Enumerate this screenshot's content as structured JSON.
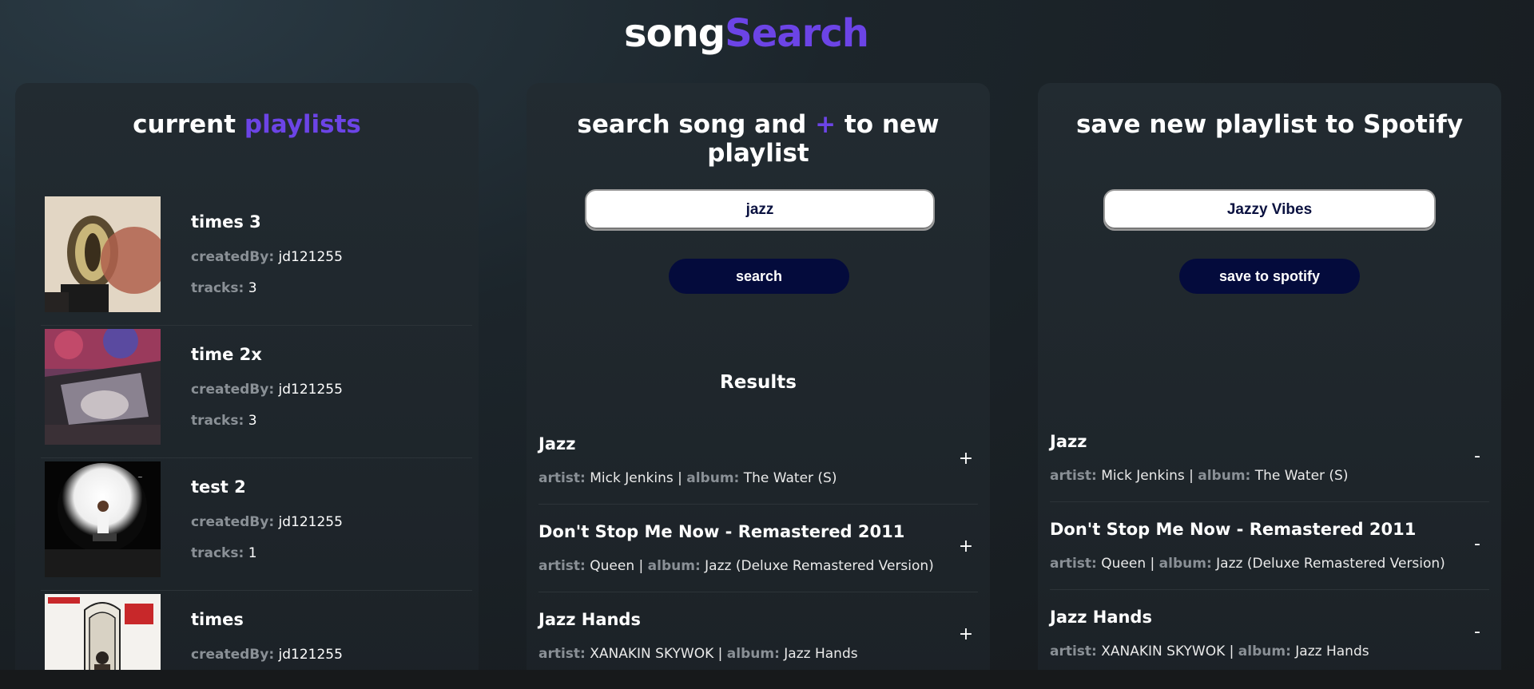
{
  "header": {
    "title_part1": "song",
    "title_part2": "Search"
  },
  "playlists_panel": {
    "title_part1": "current",
    "title_part2": "playlists",
    "created_label": "createdBy:",
    "tracks_label": "tracks:",
    "items": [
      {
        "name": "times 3",
        "created_by": "jd121255",
        "tracks": "3"
      },
      {
        "name": "time 2x",
        "created_by": "jd121255",
        "tracks": "3"
      },
      {
        "name": "test 2",
        "created_by": "jd121255",
        "tracks": "1"
      },
      {
        "name": "times",
        "created_by": "jd121255",
        "tracks": ""
      }
    ]
  },
  "search_panel": {
    "title_part1": "search song and",
    "title_plus": "+",
    "title_part2": "to new playlist",
    "search_value": "jazz",
    "search_button": "search",
    "results_title": "Results",
    "artist_label": "artist:",
    "album_label": "album:",
    "add_symbol": "+",
    "results": [
      {
        "name": "Jazz",
        "artist": "Mick Jenkins",
        "album": "The Water (S)"
      },
      {
        "name": "Don't Stop Me Now - Remastered 2011",
        "artist": "Queen",
        "album": "Jazz (Deluxe Remastered Version)"
      },
      {
        "name": "Jazz Hands",
        "artist": "XANAKIN SKYWOK",
        "album": "Jazz Hands"
      }
    ]
  },
  "save_panel": {
    "title": "save new playlist to Spotify",
    "playlist_name_value": "Jazzy Vibes",
    "save_button": "save to spotify",
    "artist_label": "artist:",
    "album_label": "album:",
    "remove_symbol": "-",
    "tracks": [
      {
        "name": "Jazz",
        "artist": "Mick Jenkins",
        "album": "The Water (S)"
      },
      {
        "name": "Don't Stop Me Now - Remastered 2011",
        "artist": "Queen",
        "album": "Jazz (Deluxe Remastered Version)"
      },
      {
        "name": "Jazz Hands",
        "artist": "XANAKIN SKYWOK",
        "album": "Jazz Hands"
      }
    ]
  },
  "colors": {
    "accent": "#6c44e6",
    "button": "#040b3c",
    "label_gray": "#8a9096"
  }
}
